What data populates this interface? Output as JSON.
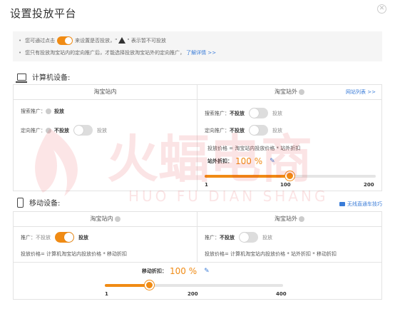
{
  "title": "设置投放平台",
  "notice": {
    "line1_pre": "您可通过点击",
    "line1_mid": "来设置是否投放，\"",
    "line1_post": "\" 表示暂不可投放",
    "line2": "您只有投放淘宝站内的定向推广后，才能选择投放淘宝站外的定向推广，",
    "line2_link": "了解详情 >>"
  },
  "pc": {
    "section_title": "计算机设备:",
    "inner_header": "淘宝站内",
    "outer_header": "淘宝站外",
    "site_list_link": "网站列表 >>",
    "inner_rows": [
      {
        "label": "搜索推广：",
        "state": "投放"
      },
      {
        "label": "定向推广：",
        "off_text": "不投放",
        "on_text": "投放"
      }
    ],
    "outer_rows": [
      {
        "label": "搜索推广：",
        "off_text": "不投放",
        "on_text": "投放"
      },
      {
        "label": "定向推广：",
        "off_text": "不投放",
        "on_text": "投放"
      }
    ],
    "formula": "投放价格 = 淘宝站内投放价格 * 站外折扣",
    "discount_label": "站外折扣：",
    "discount_value": "100 %",
    "slider": {
      "min": "1",
      "mid": "100",
      "max": "200",
      "value": 100,
      "min_num": 1,
      "max_num": 200
    }
  },
  "mobile": {
    "section_title": "移动设备:",
    "video_link": "无线直通车技巧",
    "inner_header": "淘宝站内",
    "outer_header": "淘宝站外",
    "inner_row": {
      "label": "推广：",
      "off_text": "不投放",
      "on_text": "投放"
    },
    "outer_row": {
      "label": "推广：",
      "off_text": "不投放",
      "on_text": "投放"
    },
    "inner_formula": "投放价格= 计算机淘宝站内投放价格 * 移动折扣",
    "outer_formula": "投放价格= 计算机淘宝站内投放价格 * 站外折扣 * 移动折扣",
    "discount_label": "移动折扣：",
    "discount_value": "100 %",
    "slider": {
      "min": "1",
      "mid": "200",
      "max": "400",
      "value": 100,
      "min_num": 1,
      "max_num": 400
    }
  },
  "watermark": {
    "brand": "火蝠电商",
    "pinyin": "HUO FU DIAN SHANG"
  },
  "colors": {
    "accent": "#f08b14",
    "link": "#3a7cd8",
    "watermark": "#e8383d"
  }
}
